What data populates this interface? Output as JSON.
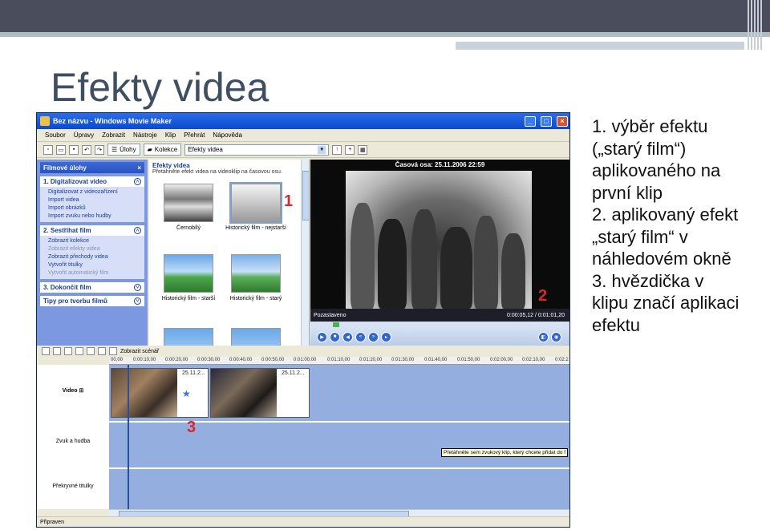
{
  "slide": {
    "title": "Efekty videa",
    "description_lines": [
      "1. výběr efektu",
      "(„starý film“)",
      "aplikovaného na",
      "první klip",
      "2. aplikovaný efekt",
      "„starý film“ v",
      "náhledovém okně",
      "3. hvězdička v",
      "klipu značí aplikaci",
      "efektu"
    ],
    "markers": [
      "1",
      "2",
      "3"
    ]
  },
  "window": {
    "title": "Bez názvu - Windows Movie Maker",
    "buttons": {
      "minimize": "_",
      "maximize": "□",
      "close": "×"
    }
  },
  "menu": [
    "Soubor",
    "Úpravy",
    "Zobrazit",
    "Nástroje",
    "Klip",
    "Přehrát",
    "Nápověda"
  ],
  "toolbar": {
    "tasks_label": "Úlohy",
    "collections_label": "Kolekce",
    "collection_select": "Efekty videa"
  },
  "task_pane": {
    "header": "Filmové úlohy",
    "sections": [
      {
        "title": "1. Digitalizovat video",
        "links": [
          "Digitalizovat z videozařízení",
          "Import videa",
          "Import obrázků",
          "Import zvuku nebo hudby"
        ]
      },
      {
        "title": "2. Sestříhat film",
        "links": [
          "Zobrazit kolekce",
          "Zobrazit efekty videa",
          "Zobrazit přechody videa",
          "Vytvořit titulky",
          "Vytvořit automatický film"
        ]
      },
      {
        "title": "3. Dokončit film",
        "links": []
      },
      {
        "title": "Tipy pro tvorbu filmů",
        "links": []
      }
    ]
  },
  "collection": {
    "title": "Efekty videa",
    "subtitle": "Přetáhněte efekt videa na videoklip na časovou osu.",
    "effects": [
      {
        "name": "Černobílý"
      },
      {
        "name": "Historický film - nejstarší"
      },
      {
        "name": "Historický film - starší"
      },
      {
        "name": "Historický film - starý"
      }
    ]
  },
  "monitor": {
    "header": "Časová osa: 25.11.2006 22:59",
    "status": "Pozastaveno",
    "time": "0:00:05,12 / 0:01:01,20"
  },
  "timeline": {
    "toggle_label": "Zobrazit scénář",
    "ruler": [
      "00,00",
      "0:00:10,00",
      "0:00:20,00",
      "0:00:30,00",
      "0:00:40,00",
      "0:00:50,00",
      "0:01:00,00",
      "0:01:10,00",
      "0:01:20,00",
      "0:01:30,00",
      "0:01:40,00",
      "0:01:50,00",
      "0:02:00,00",
      "0:02:10,00",
      "0:02:2"
    ],
    "tracks": [
      "Video",
      "Zvuk a hudba",
      "Překryvné titulky"
    ],
    "clips": [
      "25.11.2...",
      "25.11.2..."
    ],
    "tooltip": "Přetáhněte sem zvukový klip, který chcete přidat do f"
  },
  "statusbar": "Připraven"
}
